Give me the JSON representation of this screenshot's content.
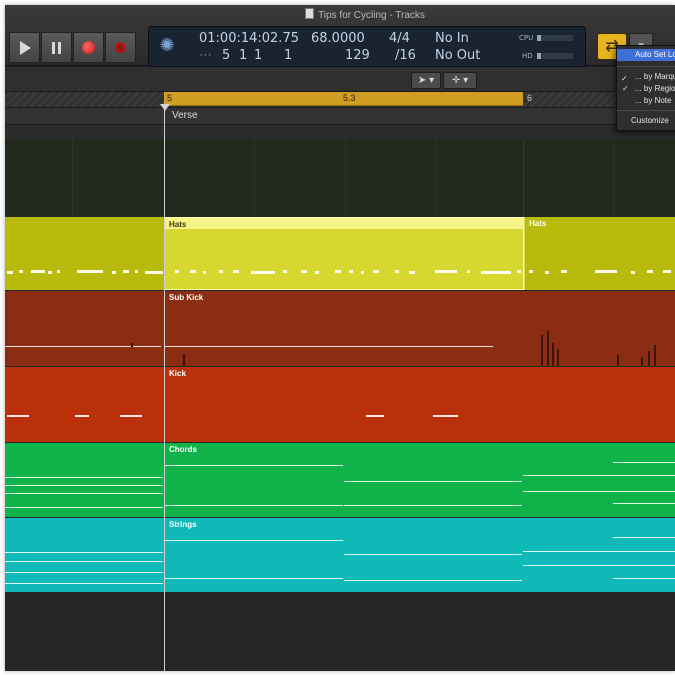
{
  "window": {
    "title": "Tips for Cycling - Tracks"
  },
  "control_bar": {
    "time": "01:00:14:02.75",
    "bars_beats": [
      "5",
      "1",
      "1",
      "1"
    ],
    "bars_beats_prefix": " ",
    "tempo": "68.0000",
    "tempo_sub": "129",
    "time_sig": "4/4",
    "division": "/16",
    "in_label": "No In",
    "out_label": "No Out",
    "cpu_label": "CPU",
    "hd_label": "HD",
    "cpu_level": 0.12,
    "hd_level": 0.1
  },
  "ruler": {
    "labels": [
      "5",
      "5.3",
      "6"
    ],
    "marker": "Verse"
  },
  "tracks": [
    {
      "name": "",
      "color": "#22291f"
    },
    {
      "name": "Hats",
      "color": "#b8ba0c",
      "second_region": "Hats"
    },
    {
      "name": "Sub Kick",
      "color": "#8a2d13"
    },
    {
      "name": "Kick",
      "color": "#b9300b"
    },
    {
      "name": "Chords",
      "color": "#0fb34a"
    },
    {
      "name": "Strings",
      "color": "#0fb9b8"
    }
  ],
  "menu": {
    "items": [
      "Auto Set Locators",
      "... by Marquee",
      "... by Region",
      "... by Note",
      "Customize"
    ],
    "checked": [
      false,
      true,
      true,
      false,
      false
    ]
  },
  "colors": {
    "cycle": "#d19e24",
    "playhead": "#cfcfcf",
    "menu_highlight": "#3f6fd6"
  }
}
